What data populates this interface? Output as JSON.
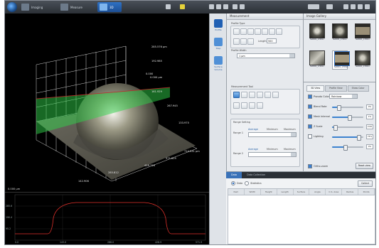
{
  "toolbar": {
    "tabs": [
      {
        "label": "Imaging",
        "active": false
      },
      {
        "label": "Measure",
        "active": false
      },
      {
        "label": "3D",
        "active": true
      }
    ]
  },
  "view3d": {
    "labels": [
      "285.576 µm",
      "192.985",
      "0.000",
      "161.929",
      "0.000 µm",
      "267.945",
      "133.975",
      "571.625",
      "428.718",
      "285.812",
      "142.906",
      "714.531 µm"
    ],
    "status": "0.000 µm"
  },
  "profile": {
    "y_ticks": [
      "285.6",
      "190.4",
      "95.2"
    ],
    "x_ticks": [
      "0.0",
      "143.0",
      "286.0",
      "428.9",
      "571.9"
    ]
  },
  "sidebar": {
    "items": [
      {
        "label": "Profile",
        "active": true
      },
      {
        "label": "Step",
        "active": false
      },
      {
        "label": "Surface Volume",
        "active": false
      }
    ]
  },
  "measurement": {
    "title": "Measurement",
    "profile_type_label": "Profile Type",
    "length_label": "Length",
    "length_value": "500",
    "profile_width_label": "Profile Width",
    "profile_width_value": "1 µm",
    "tool_label": "Measurement Tool",
    "range_label": "Range Setting",
    "range_rows": [
      {
        "label": "Range 1",
        "avg": "Average",
        "min": "Minimum",
        "max": "Maximum"
      },
      {
        "label": "Range 2",
        "avg": "Average",
        "min": "Minimum",
        "max": "Maximum"
      }
    ]
  },
  "gallery": {
    "title": "Image Gallery",
    "thumbs": [
      "NLB001_170811",
      "NLB001_170811",
      "NLB001_170811",
      "NLB001_170811",
      "NLB001_170811",
      "NLB001_170811"
    ]
  },
  "view_settings": {
    "tabs": [
      "3D View",
      "Profile View",
      "Show Color"
    ],
    "pseudo_color_label": "Pseudo Color",
    "pseudo_color_value": "Rainbow",
    "rows": [
      {
        "label": "Blend Rate",
        "value": "0%",
        "fill": 0.2
      },
      {
        "label": "Mesh Interval",
        "value": "1%",
        "fill": 0.55
      },
      {
        "label": "Z Scale",
        "value": "2.00",
        "fill": 0.1
      },
      {
        "label": "Lighting",
        "value": "75%",
        "fill": 0.85
      },
      {
        "label": "",
        "value": "0%",
        "fill": 0.4
      }
    ],
    "checkbox_label": "Ortho-zoom",
    "reset_label": "Reset view"
  },
  "data_panel": {
    "tabs": [
      "Data",
      "Data Collection"
    ],
    "radio_options": [
      "Data",
      "Statistics"
    ],
    "collect_label": "Collect",
    "columns": [
      "Item",
      "Width",
      "Height",
      "Length",
      "Surface length",
      "Angle",
      "C.S. Area",
      "Radius",
      "Points"
    ]
  },
  "colors": {
    "accent": "#3a72b8",
    "topbar": "#2b3036",
    "profile_line": "#e0302a",
    "plane": "#2fd24a"
  }
}
